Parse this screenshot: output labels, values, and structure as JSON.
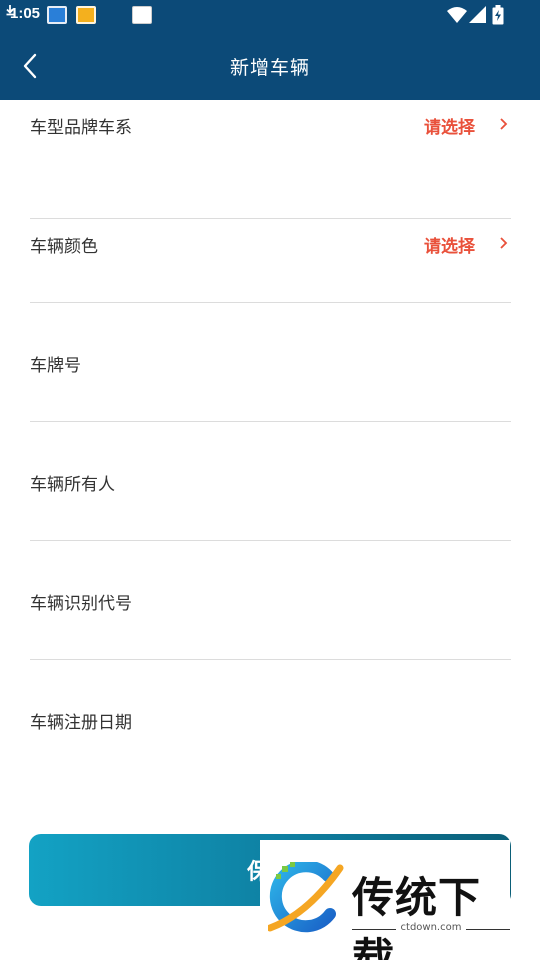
{
  "status_bar": {
    "time": "1:05",
    "icons": [
      "app-icon",
      "app-icon",
      "download-icon",
      "app-icon",
      "wifi-icon",
      "signal-icon",
      "battery-charging-icon"
    ]
  },
  "app_bar": {
    "title": "新增车辆",
    "back_icon": "back-arrow-icon",
    "color": "#0c4a78"
  },
  "form": {
    "fields": [
      {
        "label": "车型品牌车系",
        "value": "请选择",
        "has_chevron": true
      },
      {
        "label": "车辆颜色",
        "value": "请选择",
        "has_chevron": true
      },
      {
        "label": "车牌号",
        "value": ""
      },
      {
        "label": "车辆所有人",
        "value": ""
      },
      {
        "label": "车辆识别代号",
        "value": ""
      },
      {
        "label": "车辆注册日期",
        "value": ""
      }
    ],
    "select_color": "#e9513b"
  },
  "save_button": {
    "label": "保"
  },
  "watermark": {
    "text": "传统下载",
    "url": "ctdown.com"
  }
}
